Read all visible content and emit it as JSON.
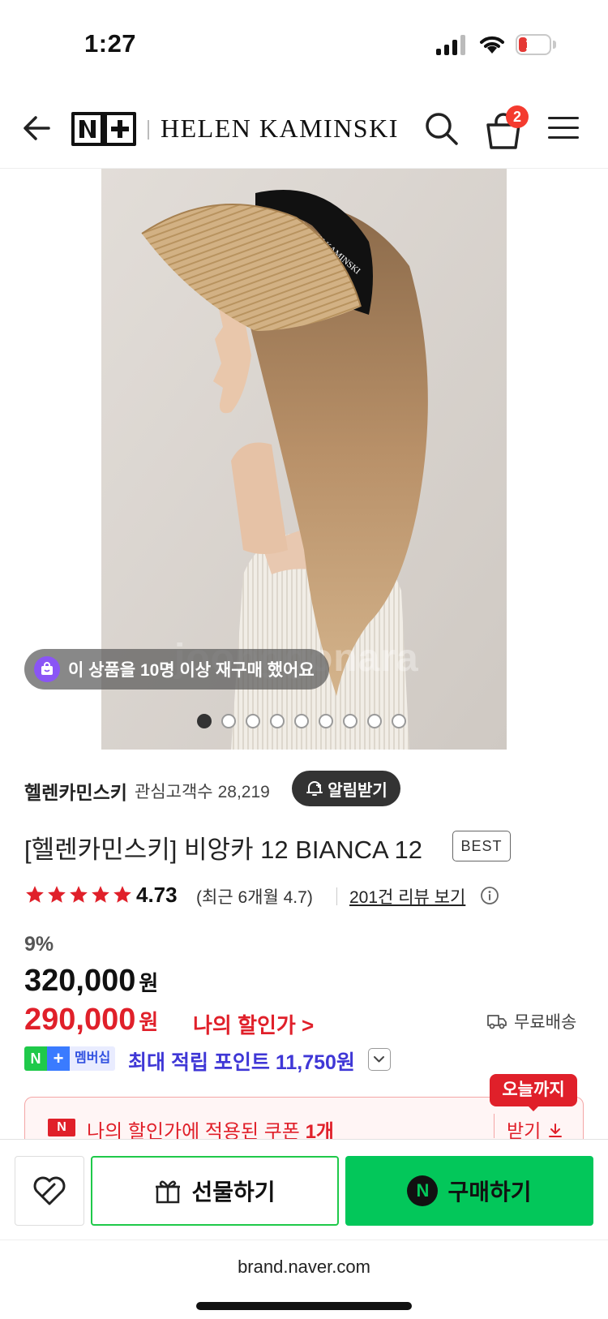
{
  "status_bar": {
    "time": "1:27",
    "battery": "10"
  },
  "header": {
    "nplus_logo": "N+",
    "brand_name": "HELEN KAMINSKI",
    "cart_count": "2",
    "icons": [
      "back-arrow-icon",
      "search-icon",
      "cart-icon",
      "menu-icon"
    ]
  },
  "gallery": {
    "repurchase_notice": "이 상품을 10명 이상 재구매 했어요",
    "watermark": "joonggonara",
    "image_count": 9,
    "active_index": 0
  },
  "store": {
    "name": "헬렌카민스키",
    "followers_label": "관심고객수",
    "followers_count": "28,219",
    "alarm_label": "알림받기"
  },
  "product": {
    "title": "[헬렌카민스키] 비앙카 12 BIANCA 12",
    "badge": "BEST",
    "rating": "4.73",
    "rating_stars": 5,
    "recent_rating": "(최근 6개월 4.7)",
    "review_link": "201건 리뷰 보기",
    "star_color": "#e0202a"
  },
  "price": {
    "discount_rate": "9%",
    "original": "320,000",
    "sale": "290,000",
    "currency": "원",
    "my_discount_label": "나의 할인가 >",
    "shipping": "무료배송",
    "sale_color": "#e0202a"
  },
  "membership": {
    "badge_n": "N",
    "badge_plus": "+",
    "badge_label": "멤버십",
    "points_text": "최대 적립 포인트 11,750원",
    "points_color": "#3f37d6"
  },
  "coupon": {
    "n_mark": "N",
    "text_prefix": "나의 할인가에 적용된 쿠폰",
    "count": "1개",
    "get_label": "받기",
    "today_tag": "오늘까지"
  },
  "actions": {
    "gift_label": "선물하기",
    "buy_label": "구매하기",
    "buy_n": "N",
    "buy_color": "#03c75a"
  },
  "browser": {
    "url": "brand.naver.com"
  }
}
